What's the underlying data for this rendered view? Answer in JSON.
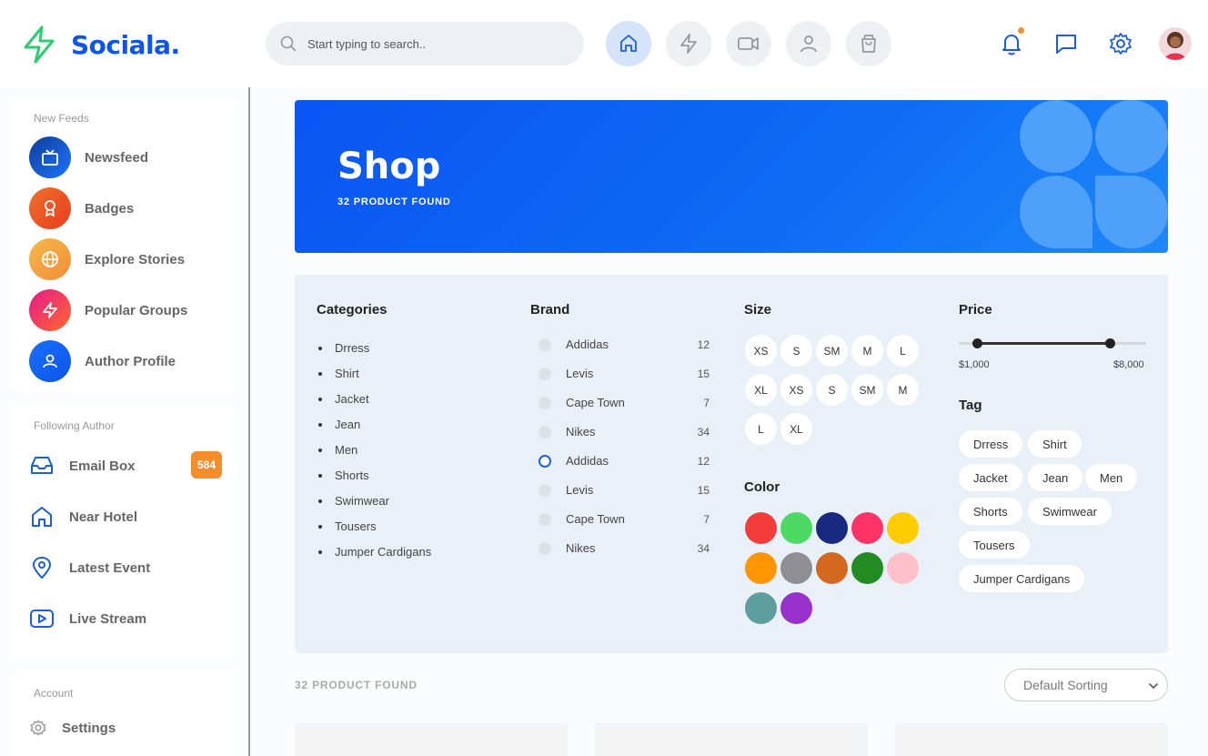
{
  "header": {
    "brand": "Sociala.",
    "search_placeholder": "Start typing to search..",
    "nav_icons": [
      "home-icon",
      "lightning-icon",
      "video-icon",
      "user-icon",
      "shopping-bag-icon"
    ],
    "right_icons": [
      "bell-icon",
      "chat-icon",
      "gear-icon",
      "avatar"
    ]
  },
  "sidebar": {
    "new_feeds": {
      "title": "New Feeds",
      "items": [
        {
          "label": "Newsfeed",
          "icon": "tv-icon",
          "color": "#1a5fd6"
        },
        {
          "label": "Badges",
          "icon": "award-icon",
          "color": "#f4511e"
        },
        {
          "label": "Explore Stories",
          "icon": "globe-icon",
          "color": "#f5a623"
        },
        {
          "label": "Popular Groups",
          "icon": "lightning-icon",
          "color": "#ff3d71"
        },
        {
          "label": "Author Profile",
          "icon": "user-icon",
          "color": "#1e74fd"
        }
      ]
    },
    "following": {
      "title": "Following Author",
      "items": [
        {
          "label": "Email Box",
          "icon": "inbox-icon",
          "badge": "584"
        },
        {
          "label": "Near Hotel",
          "icon": "home-icon"
        },
        {
          "label": "Latest Event",
          "icon": "map-pin-icon"
        },
        {
          "label": "Live Stream",
          "icon": "youtube-icon"
        }
      ]
    },
    "account": {
      "title": "Account",
      "items": [
        {
          "label": "Settings",
          "icon": "gear-icon"
        }
      ]
    }
  },
  "banner": {
    "title": "Shop",
    "subtitle": "32 PRODUCT FOUND"
  },
  "filters": {
    "categories": {
      "title": "Categories",
      "items": [
        "Drress",
        "Shirt",
        "Jacket",
        "Jean",
        "Men",
        "Shorts",
        "Swimwear",
        "Tousers",
        "Jumper Cardigans"
      ]
    },
    "brand": {
      "title": "Brand",
      "items": [
        {
          "name": "Addidas",
          "count": "12",
          "selected": false
        },
        {
          "name": "Levis",
          "count": "15",
          "selected": false
        },
        {
          "name": "Cape Town",
          "count": "7",
          "selected": false
        },
        {
          "name": "Nikes",
          "count": "34",
          "selected": false
        },
        {
          "name": "Addidas",
          "count": "12",
          "selected": true
        },
        {
          "name": "Levis",
          "count": "15",
          "selected": false
        },
        {
          "name": "Cape Town",
          "count": "7",
          "selected": false
        },
        {
          "name": "Nikes",
          "count": "34",
          "selected": false
        }
      ]
    },
    "size": {
      "title": "Size",
      "items": [
        "XS",
        "S",
        "SM",
        "M",
        "L",
        "XL",
        "XS",
        "S",
        "SM",
        "M",
        "L",
        "XL"
      ]
    },
    "color": {
      "title": "Color",
      "items": [
        "#f23b3b",
        "#4cd964",
        "#172a80",
        "#ff3366",
        "#ffcc00",
        "#ff9500",
        "#8e8e93",
        "#d2691e",
        "#228b22",
        "#ffc0cb",
        "#5f9ea0",
        "#9932cc"
      ]
    },
    "price": {
      "title": "Price",
      "min_label": "$1,000",
      "max_label": "$8,000"
    },
    "tag": {
      "title": "Tag",
      "items": [
        "Drress",
        "Shirt",
        "Jacket",
        "Jean",
        "Men",
        "Shorts",
        "Swimwear",
        "Tousers",
        "Jumper Cardigans"
      ]
    }
  },
  "results": {
    "count_label": "32 PRODUCT FOUND",
    "sort_label": "Default Sorting"
  }
}
